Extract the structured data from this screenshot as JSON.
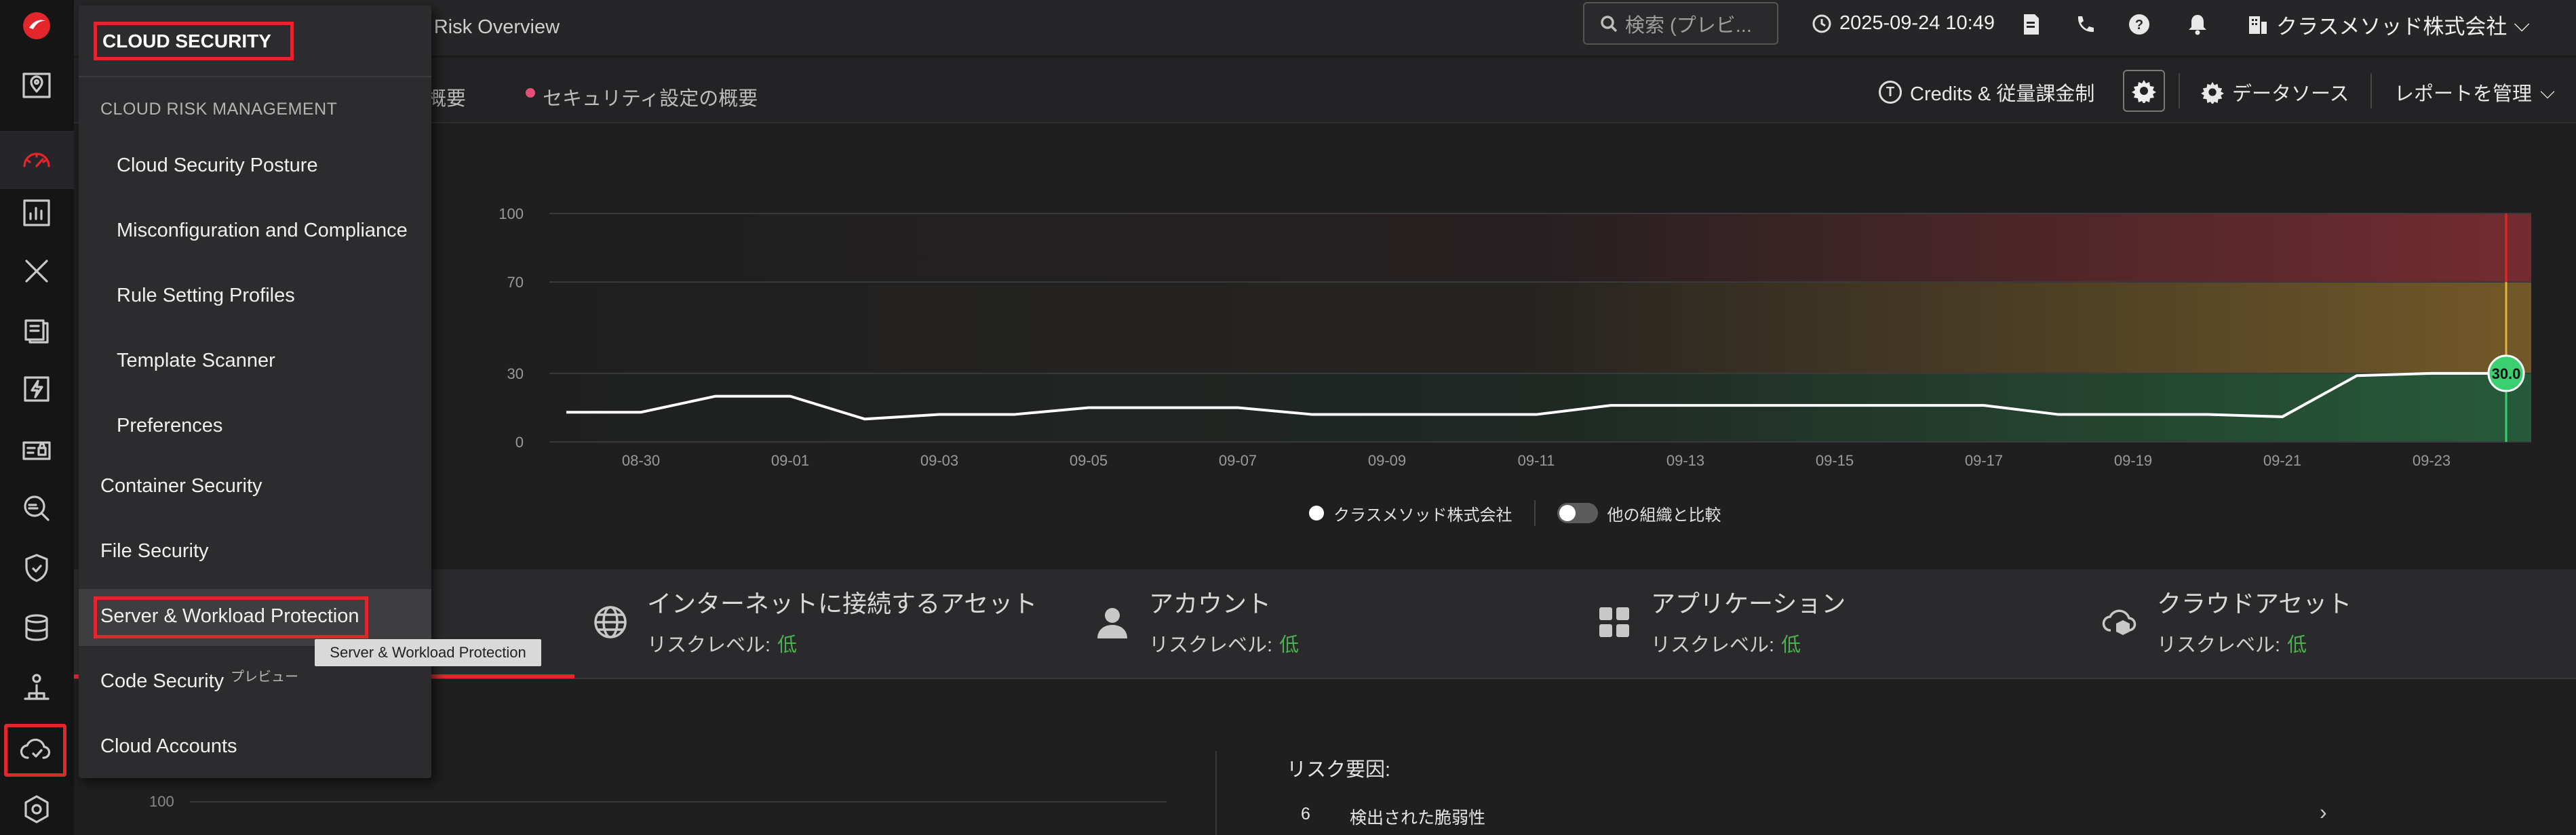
{
  "header": {
    "page_title": "r Risk Overview",
    "search_placeholder": "検索 (プレビ...",
    "datetime": "2025-09-24 10:49",
    "org_name": "クラスメソッド株式会社"
  },
  "subbar": {
    "tab_partial": "の概要",
    "tab_security": "セキュリティ設定の概要",
    "credits_label": "Credits & 従量課金制",
    "datasource_label": "データソース",
    "report_label": "レポートを管理"
  },
  "chart_data": {
    "type": "line",
    "yticks": [
      "100",
      "70",
      "30",
      "0"
    ],
    "ylim": [
      0,
      100
    ],
    "x": [
      "08-29",
      "08-30",
      "08-31",
      "09-01",
      "09-02",
      "09-03",
      "09-04",
      "09-05",
      "09-06",
      "09-07",
      "09-08",
      "09-09",
      "09-10",
      "09-11",
      "09-12",
      "09-13",
      "09-14",
      "09-15",
      "09-16",
      "09-17",
      "09-18",
      "09-19",
      "09-20",
      "09-21",
      "09-22",
      "09-23",
      "09-24"
    ],
    "xticks": [
      "08-30",
      "09-01",
      "09-03",
      "09-05",
      "09-07",
      "09-09",
      "09-11",
      "09-13",
      "09-15",
      "09-17",
      "09-19",
      "09-21",
      "09-23"
    ],
    "series": [
      {
        "name": "クラスメソッド株式会社",
        "values": [
          13,
          13,
          20,
          20,
          10,
          12,
          12,
          15,
          15,
          15,
          12,
          12,
          12,
          12,
          16,
          16,
          16,
          16,
          16,
          16,
          12,
          12,
          12,
          11,
          29,
          30,
          30
        ]
      }
    ],
    "current_value": "30.0",
    "bands": [
      {
        "from": 70,
        "to": 100,
        "color": "#b8373d"
      },
      {
        "from": 30,
        "to": 70,
        "color": "#b7882f"
      },
      {
        "from": 0,
        "to": 30,
        "color": "#2e8b4f"
      }
    ]
  },
  "legend": {
    "series_label": "クラスメソッド株式会社",
    "compare_label": "他の組織と比較"
  },
  "categories": [
    {
      "title": "インターネットに接続するアセット",
      "risk_label": "リスクレベル:",
      "risk_value": "低"
    },
    {
      "title": "アカウント",
      "risk_label": "リスクレベル:",
      "risk_value": "低"
    },
    {
      "title": "アプリケーション",
      "risk_label": "リスクレベル:",
      "risk_value": "低"
    },
    {
      "title": "クラウドアセット",
      "risk_label": "リスクレベル:",
      "risk_value": "低"
    }
  ],
  "bottom": {
    "y_label": "100",
    "risk_factors_title": "リスク要因:",
    "rf_count": "6",
    "rf_label": "検出された脆弱性"
  },
  "menu": {
    "title": "CLOUD SECURITY",
    "section": "CLOUD RISK MANAGEMENT",
    "sub_items": [
      "Cloud Security Posture",
      "Misconfiguration and Compliance",
      "Rule Setting Profiles",
      "Template Scanner",
      "Preferences"
    ],
    "items": [
      "Container Security",
      "File Security",
      "Server & Workload Protection",
      "Code Security",
      "Cloud Accounts"
    ],
    "preview_tag": "プレビュー",
    "tooltip": "Server & Workload Protection"
  },
  "colors": {
    "accent": "#e3262c",
    "low_risk": "#4caf50",
    "current_marker": "#3ad06f"
  }
}
